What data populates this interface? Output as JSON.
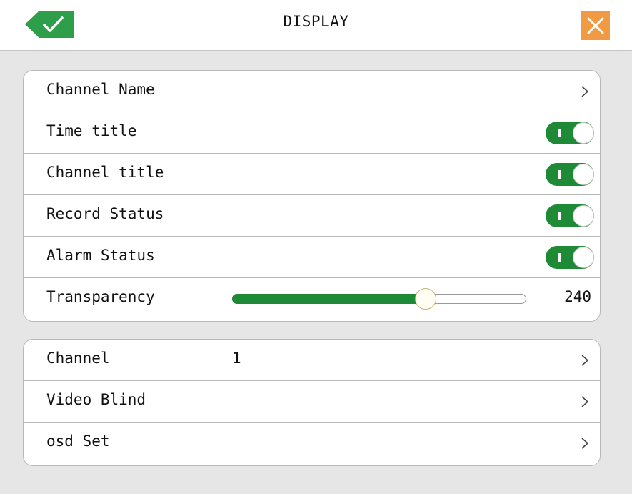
{
  "header": {
    "title": "DISPLAY",
    "ok_icon": "checkmark-icon",
    "close_icon": "close-icon",
    "colors": {
      "ok": "#2e9e4a",
      "close": "#f09a43"
    }
  },
  "display_settings": {
    "channel_name_label": "Channel Name",
    "time_title": {
      "label": "Time title",
      "enabled": true
    },
    "channel_title": {
      "label": "Channel title",
      "enabled": true
    },
    "record_status": {
      "label": "Record Status",
      "enabled": true
    },
    "alarm_status": {
      "label": "Alarm Status",
      "enabled": true
    },
    "transparency": {
      "label": "Transparency",
      "value": "240",
      "max": 255
    }
  },
  "channel_settings": {
    "channel_label": "Channel",
    "channel_value": "1",
    "video_blind_label": "Video Blind",
    "osd_set_label": "osd Set"
  },
  "accent_color": "#1f8a35"
}
